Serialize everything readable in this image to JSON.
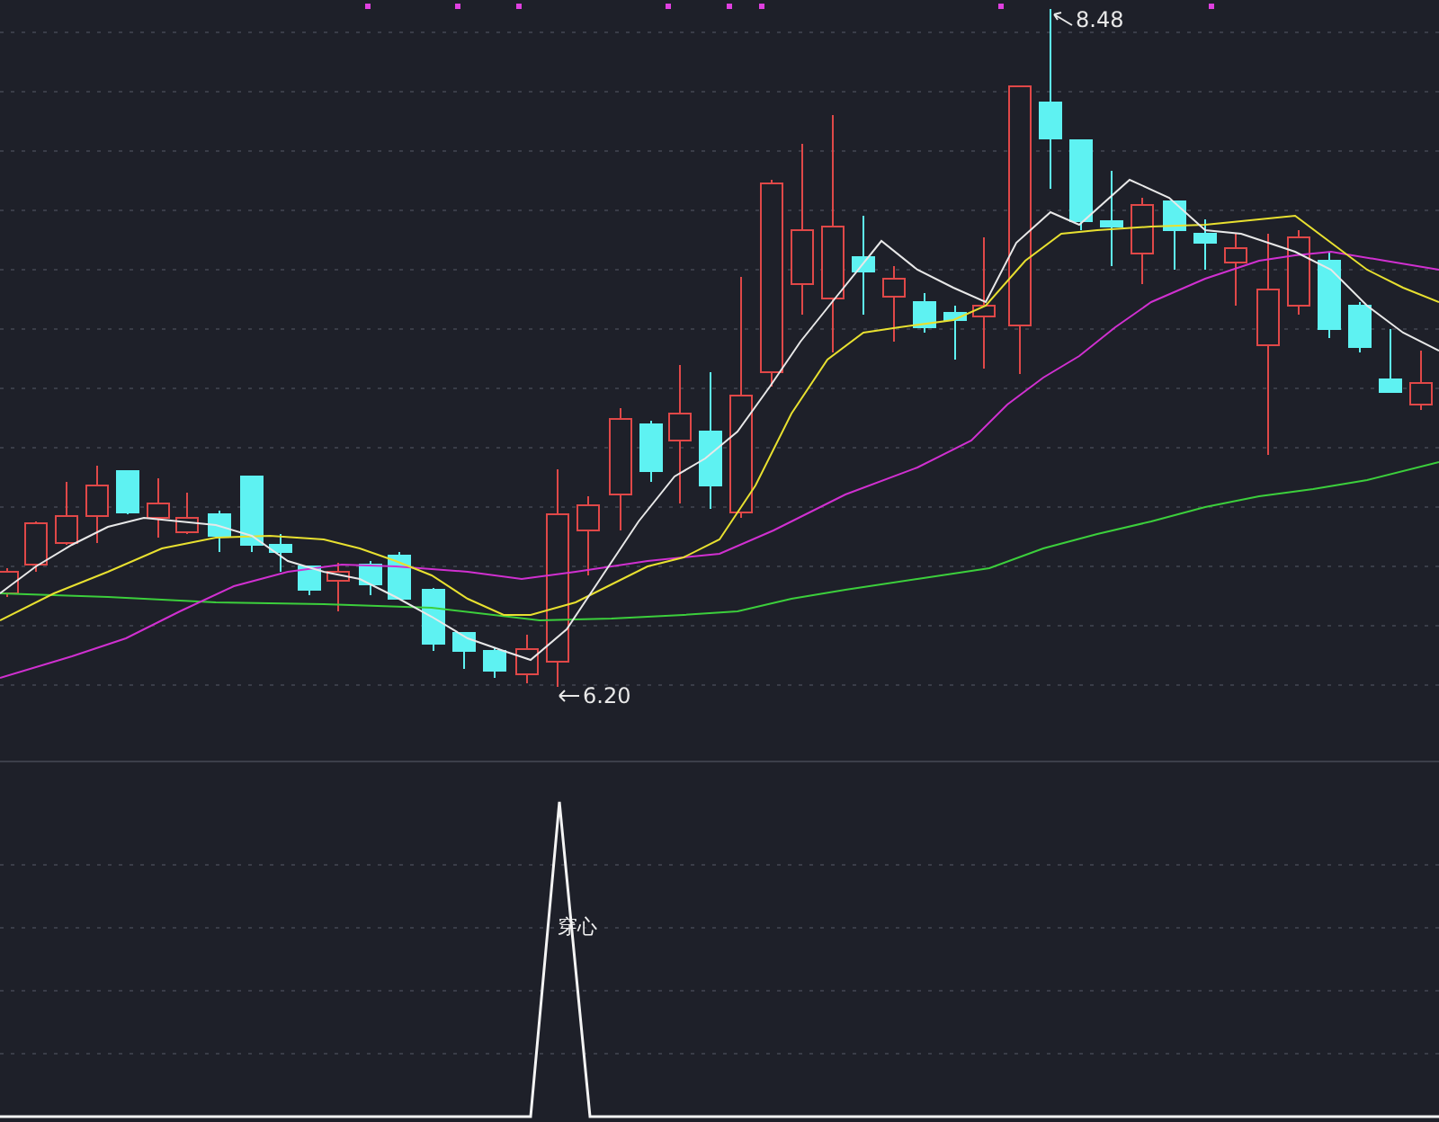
{
  "main_chart": {
    "high_label": "8.48",
    "low_label": "6.20"
  },
  "indicator": {
    "signal_label": "穿心"
  }
}
